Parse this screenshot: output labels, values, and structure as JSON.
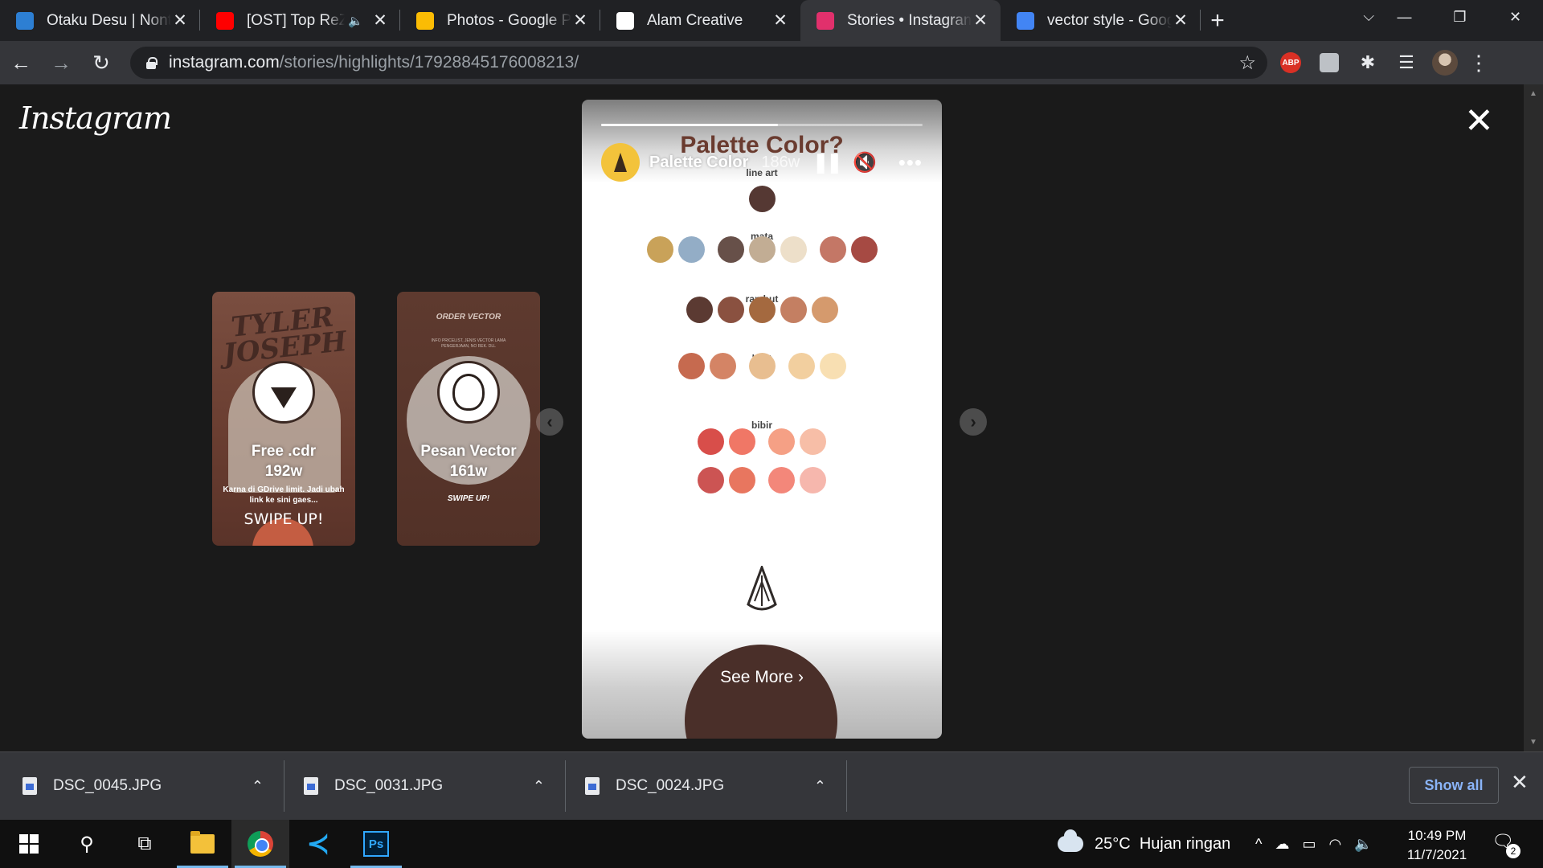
{
  "browser": {
    "tabs": [
      {
        "title": "Otaku Desu | Nonton",
        "favicon": "otakudesu-favicon",
        "color": "#2d7fd3"
      },
      {
        "title": "[OST] Top ReZero",
        "favicon": "youtube-favicon",
        "color": "#ff0000",
        "audio": "🔈"
      },
      {
        "title": "Photos - Google Photos",
        "favicon": "google-photos-favicon",
        "color": "#fbbc04"
      },
      {
        "title": "Alam Creative",
        "favicon": "alam-creative-favicon",
        "color": "#ffffff"
      },
      {
        "title": "Stories • Instagram",
        "favicon": "instagram-favicon",
        "color": "#e1306c",
        "active": true
      },
      {
        "title": "vector style - Google",
        "favicon": "google-favicon",
        "color": "#4285f4"
      }
    ],
    "close_glyph": "✕",
    "newtab_glyph": "+",
    "tabsearch_glyph": "⌵",
    "window": {
      "minimize": "—",
      "restore": "❐",
      "close": "✕"
    },
    "nav": {
      "back": "←",
      "forward": "→",
      "reload": "↻"
    },
    "url_host": "instagram.com",
    "url_path": "/stories/highlights/17928845176008213/",
    "star": "☆",
    "ext_abp": "ABP",
    "ext_puzzle": "✱",
    "ext_queue": "☰",
    "menu": "⋮"
  },
  "instagram": {
    "logo": "Instagram",
    "close": "✕",
    "previews": [
      {
        "art_title": "TYLER JOSEPH",
        "name": "Free .cdr",
        "age": "192w",
        "sub": "Karna di GDrive limit. Jadi ubah link ke sini gaes...",
        "swipe": "SWIPE UP!"
      },
      {
        "art_title": "ORDER VECTOR",
        "art_sub": "INFO PRICELIST, JENIS VECTOR LAMA PENGERJAAN, NO REK. DLL",
        "name": "Pesan Vector",
        "age": "161w",
        "swipe": "SWIPE UP!"
      }
    ],
    "arrow_left": "‹",
    "arrow_right": "›",
    "story": {
      "bg_title": "Palette Color?",
      "username": "Palette Color",
      "age": "186w",
      "progress": 0.55,
      "pause": "❚❚",
      "mute": "🔇",
      "more": "•••",
      "see_more": "See More  ›",
      "palette": [
        {
          "label": "line art",
          "colors": [
            [
              "#553833"
            ]
          ]
        },
        {
          "label": "mata",
          "colors": [
            [
              "#c9a259",
              "#93adc6"
            ],
            [
              "#675049",
              "#c2ad94",
              "#eddfc9"
            ],
            [
              "#c47766",
              "#a64a43"
            ]
          ]
        },
        {
          "label": "rambut",
          "colors": [
            [
              "#5b3a32",
              "#8a5140",
              "#a4693f",
              "#c47f62",
              "#d59a6d"
            ]
          ]
        },
        {
          "label": "kulit",
          "colors": [
            [
              "#c66a4f",
              "#d48465"
            ],
            [
              "#e8be90"
            ],
            [
              "#f2cf9f",
              "#f8dfb2"
            ]
          ]
        },
        {
          "label": "bibir",
          "colors": [
            [
              "#d84e4a",
              "#f07766"
            ],
            [
              "#f5a085",
              "#f7bea7"
            ]
          ],
          "colors_row2": [
            [
              "#cc5453",
              "#e8765f"
            ],
            [
              "#f3877a",
              "#f6b7ad"
            ]
          ]
        }
      ]
    }
  },
  "downloads": {
    "items": [
      "DSC_0045.JPG",
      "DSC_0031.JPG",
      "DSC_0024.JPG"
    ],
    "chevron": "⌃",
    "show_all": "Show all",
    "close": "✕"
  },
  "taskbar": {
    "search": "⚲",
    "taskview": "⧉",
    "vscode": "≺",
    "ps": "Ps",
    "temp": "25°C",
    "weather": "Hujan ringan",
    "tray_up": "^",
    "tray_cloud": "☁",
    "tray_battery": "▭",
    "tray_wifi": "◠",
    "tray_volume": "🔈",
    "time": "10:49 PM",
    "date": "11/7/2021",
    "notif_glyph": "🗨",
    "notif_count": "2"
  }
}
